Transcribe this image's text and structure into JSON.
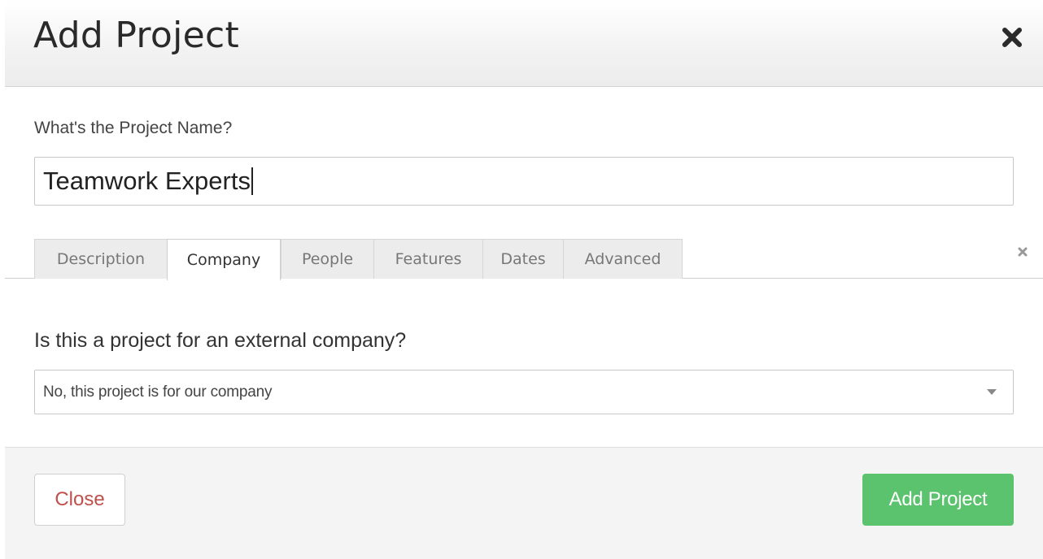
{
  "modal": {
    "title": "Add Project",
    "close_icon": "close-x-icon"
  },
  "project_name": {
    "label": "What's the Project Name?",
    "value": "Teamwork Experts"
  },
  "tabs": {
    "items": [
      {
        "label": "Description",
        "active": false
      },
      {
        "label": "Company",
        "active": true
      },
      {
        "label": "People",
        "active": false
      },
      {
        "label": "Features",
        "active": false
      },
      {
        "label": "Dates",
        "active": false
      },
      {
        "label": "Advanced",
        "active": false
      }
    ],
    "close_icon": "close-x-icon"
  },
  "company": {
    "question": "Is this a project for an external company?",
    "selected": "No, this project is for our company",
    "dropdown_icon": "caret-down-icon"
  },
  "footer": {
    "close_label": "Close",
    "submit_label": "Add Project"
  },
  "colors": {
    "primary_button": "#5bc26e",
    "close_text": "#c0504d"
  }
}
